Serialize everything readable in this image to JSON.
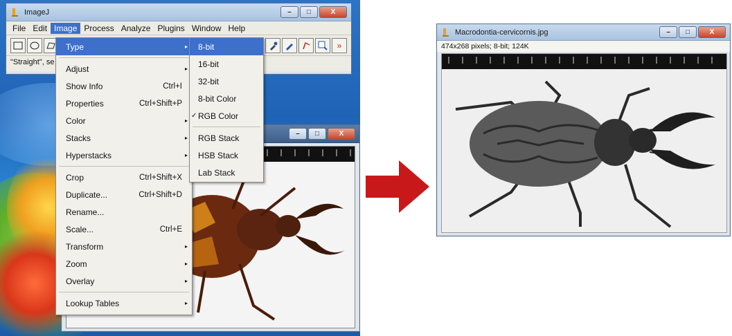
{
  "main_window": {
    "title": "ImageJ",
    "menus": [
      "File",
      "Edit",
      "Image",
      "Process",
      "Analyze",
      "Plugins",
      "Window",
      "Help"
    ],
    "active_menu": "Image",
    "status": "\"Straight\", se"
  },
  "image_menu": {
    "items": [
      {
        "label": "Type",
        "shortcut": "",
        "submenu": true,
        "highlighted": true
      },
      {
        "label": "Adjust",
        "shortcut": "",
        "submenu": true
      },
      {
        "label": "Show Info",
        "shortcut": "Ctrl+I",
        "submenu": false
      },
      {
        "label": "Properties",
        "shortcut": "Ctrl+Shift+P",
        "submenu": false
      },
      {
        "label": "Color",
        "shortcut": "",
        "submenu": true
      },
      {
        "label": "Stacks",
        "shortcut": "",
        "submenu": true
      },
      {
        "label": "Hyperstacks",
        "shortcut": "",
        "submenu": true
      },
      {
        "label": "Crop",
        "shortcut": "Ctrl+Shift+X",
        "submenu": false
      },
      {
        "label": "Duplicate...",
        "shortcut": "Ctrl+Shift+D",
        "submenu": false
      },
      {
        "label": "Rename...",
        "shortcut": "",
        "submenu": false
      },
      {
        "label": "Scale...",
        "shortcut": "Ctrl+E",
        "submenu": false
      },
      {
        "label": "Transform",
        "shortcut": "",
        "submenu": true
      },
      {
        "label": "Zoom",
        "shortcut": "",
        "submenu": true
      },
      {
        "label": "Overlay",
        "shortcut": "",
        "submenu": true
      },
      {
        "label": "Lookup Tables",
        "shortcut": "",
        "submenu": true
      }
    ]
  },
  "type_menu": {
    "items": [
      {
        "label": "8-bit",
        "highlighted": true,
        "checked": false
      },
      {
        "label": "16-bit",
        "checked": false
      },
      {
        "label": "32-bit",
        "checked": false
      },
      {
        "label": "8-bit Color",
        "checked": false
      },
      {
        "label": "RGB Color",
        "checked": true
      },
      {
        "label": "RGB Stack",
        "checked": false
      },
      {
        "label": "HSB Stack",
        "checked": false
      },
      {
        "label": "Lab Stack",
        "checked": false
      }
    ],
    "check_glyph": "✓"
  },
  "result_window": {
    "title": "Macrodontia-cervicornis.jpg",
    "info": "474x268 pixels; 8-bit; 124K"
  },
  "glyphs": {
    "submenu_arrow": "▸",
    "minimize": "–",
    "maximize": "□",
    "close": "X",
    "more": "»"
  },
  "colors": {
    "highlight": "#3d6fcb",
    "arrow": "#c9181a"
  }
}
